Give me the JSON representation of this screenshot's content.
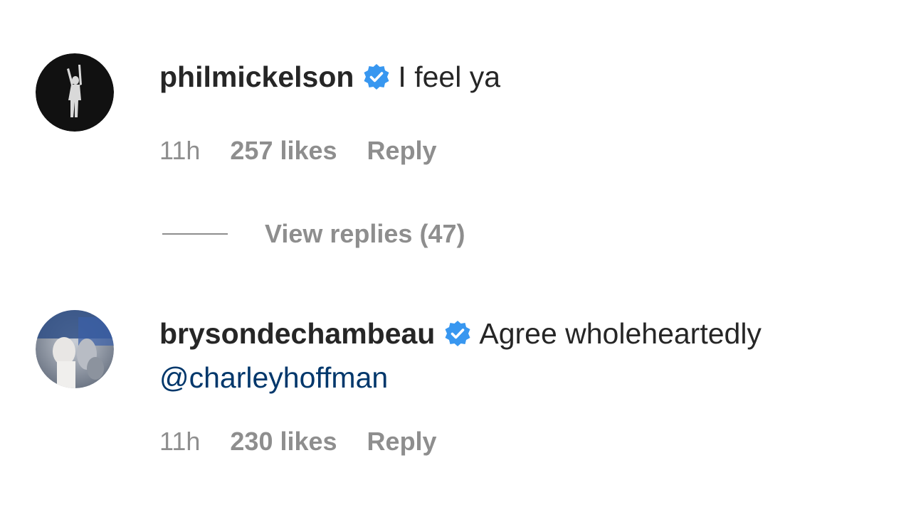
{
  "comments": [
    {
      "username": "philmickelson",
      "verified": true,
      "text": "I feel ya",
      "mention": "",
      "time": "11h",
      "likes": "257 likes",
      "reply_label": "Reply",
      "avatar_icon": "golfer-silhouette-avatar"
    },
    {
      "username": "brysondechambeau",
      "verified": true,
      "text": "Agree wholeheartedly",
      "mention": "@charleyhoffman",
      "time": "11h",
      "likes": "230 likes",
      "reply_label": "Reply",
      "avatar_icon": "photo-avatar"
    }
  ],
  "view_replies": {
    "label": "View replies (47)"
  },
  "colors": {
    "verified_badge": "#3897f0",
    "meta_text": "#8e8e8e",
    "mention": "#00376b",
    "primary_text": "#262626"
  }
}
